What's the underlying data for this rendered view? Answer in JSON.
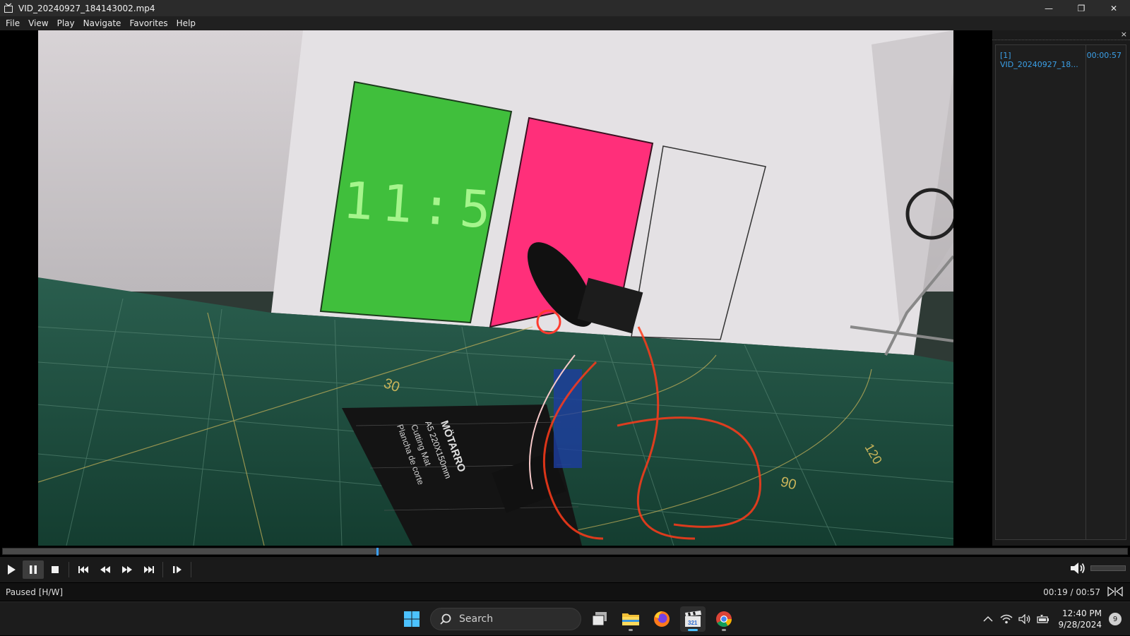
{
  "window": {
    "title": "VID_20240927_184143002.mp4",
    "controls": {
      "minimize": "—",
      "restore": "❐",
      "close": "✕"
    }
  },
  "menu": [
    "File",
    "View",
    "Play",
    "Navigate",
    "Favorites",
    "Help"
  ],
  "video": {
    "scene_digits": "11:5",
    "mat_brand": "MÖTARRO",
    "mat_size": "A5 220X150mm",
    "mat_line1": "Cutting Mat",
    "mat_line2": "Plancha de corte",
    "mat_marks": [
      "30",
      "90",
      "120"
    ]
  },
  "playlist": {
    "close": "×",
    "items": [
      {
        "label": "[1]  VID_20240927_18...",
        "duration": "00:00:57"
      }
    ]
  },
  "playback": {
    "progress": 0.333,
    "status": "Paused [H/W]",
    "time": "00:19 / 00:57"
  },
  "taskbar": {
    "search_label": "Search",
    "clock_time": "12:40 PM",
    "clock_date": "9/28/2024",
    "notification_count": "9"
  },
  "colors": {
    "accent": "#3aa0ff",
    "playlist_text": "#3ba0e8",
    "green_panel": "#3fbf3a",
    "pink_panel": "#ff2f7a",
    "mat": "#1f5a48"
  }
}
